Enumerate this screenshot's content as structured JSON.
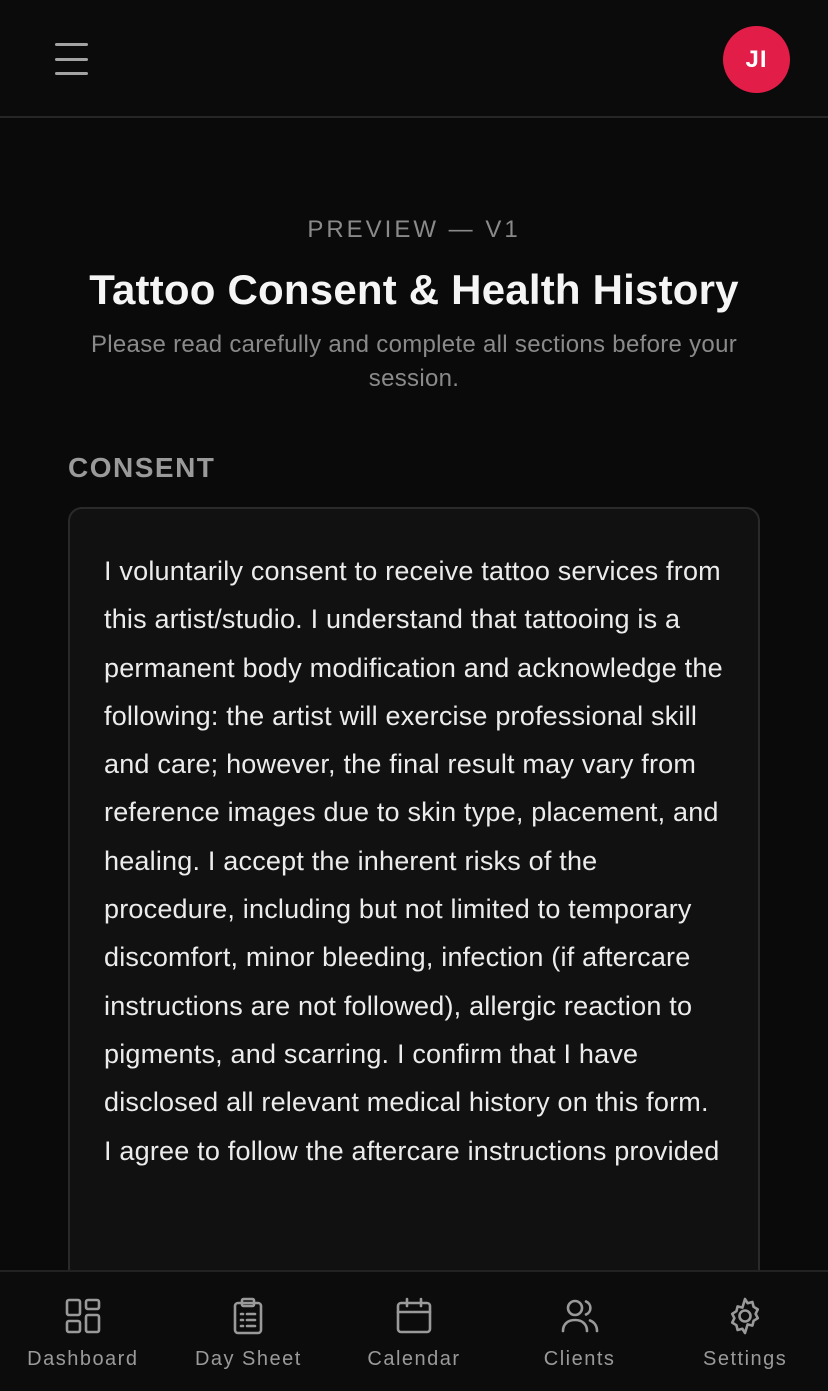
{
  "topbar": {
    "menu_icon": "menu-icon",
    "avatar_initials": "JI",
    "avatar_color": "#e11d48"
  },
  "header": {
    "eyebrow": "PREVIEW — V1",
    "title": "Tattoo Consent & Health History",
    "subtitle": "Please read carefully and complete all sections before your session."
  },
  "consent": {
    "section_label": "CONSENT",
    "text": "I voluntarily consent to receive tattoo services from this artist/studio. I understand that tattooing is a permanent body modification and acknowledge the following: the artist will exercise professional skill and care; however, the final result may vary from reference images due to skin type, placement, and healing. I accept the inherent risks of the procedure, including but not limited to temporary discomfort, minor bleeding, infection (if aftercare instructions are not followed), allergic reaction to pigments, and scarring. I confirm that I have disclosed all relevant medical history on this form. I agree to follow the aftercare instructions provided"
  },
  "bottom_nav": {
    "items": [
      {
        "label": "Dashboard",
        "icon": "dashboard-grid-icon"
      },
      {
        "label": "Day Sheet",
        "icon": "clipboard-icon"
      },
      {
        "label": "Calendar",
        "icon": "calendar-icon"
      },
      {
        "label": "Clients",
        "icon": "users-icon"
      },
      {
        "label": "Settings",
        "icon": "gear-icon"
      }
    ]
  }
}
